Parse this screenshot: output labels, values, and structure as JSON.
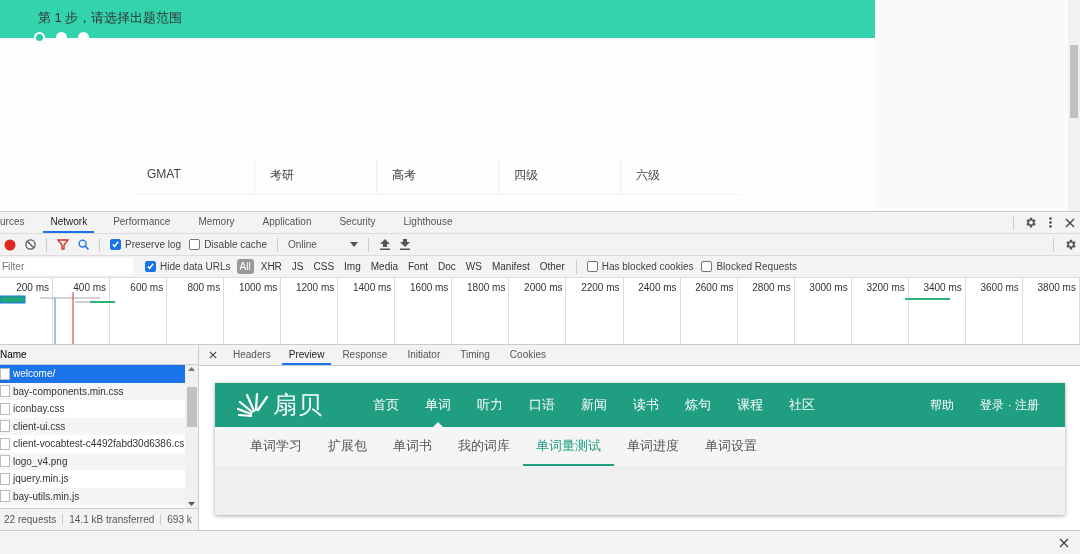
{
  "page": {
    "step_title": "第 1 步，请选择出题范围",
    "steps": [
      {
        "selected": true
      },
      {
        "selected": false
      },
      {
        "selected": false
      }
    ],
    "categories": [
      "GMAT",
      "考研",
      "高考",
      "四级",
      "六级"
    ]
  },
  "devtools": {
    "tabs": [
      {
        "label": "urces",
        "selected": false
      },
      {
        "label": "Network",
        "selected": true
      },
      {
        "label": "Performance",
        "selected": false
      },
      {
        "label": "Memory",
        "selected": false
      },
      {
        "label": "Application",
        "selected": false
      },
      {
        "label": "Security",
        "selected": false
      },
      {
        "label": "Lighthouse",
        "selected": false
      }
    ],
    "toolbar": {
      "checkboxes": [
        {
          "label": "Preserve log",
          "checked": true
        },
        {
          "label": "Disable cache",
          "checked": false
        }
      ],
      "throttle": "Online"
    },
    "filter_bar": {
      "placeholder": "Filter",
      "hide_data_urls": {
        "label": "Hide data URLs",
        "checked": true
      },
      "types": [
        {
          "label": "All",
          "selected": true
        },
        {
          "label": "XHR",
          "selected": false
        },
        {
          "label": "JS",
          "selected": false
        },
        {
          "label": "CSS",
          "selected": false
        },
        {
          "label": "Img",
          "selected": false
        },
        {
          "label": "Media",
          "selected": false
        },
        {
          "label": "Font",
          "selected": false
        },
        {
          "label": "Doc",
          "selected": false
        },
        {
          "label": "WS",
          "selected": false
        },
        {
          "label": "Manifest",
          "selected": false
        },
        {
          "label": "Other",
          "selected": false
        }
      ],
      "blocked_options": [
        {
          "label": "Has blocked cookies",
          "checked": false
        },
        {
          "label": "Blocked Requests",
          "checked": false
        }
      ]
    },
    "timeline": {
      "ticks": [
        "200 ms",
        "400 ms",
        "600 ms",
        "800 ms",
        "1000 ms",
        "1200 ms",
        "1400 ms",
        "1600 ms",
        "1800 ms",
        "2000 ms",
        "2200 ms",
        "2400 ms",
        "2600 ms",
        "2800 ms",
        "3000 ms",
        "3200 ms",
        "3400 ms",
        "3600 ms",
        "3800 ms"
      ]
    },
    "requests": {
      "column": "Name",
      "rows": [
        {
          "name": "welcome/",
          "selected": true
        },
        {
          "name": "bay-components.min.css",
          "selected": false
        },
        {
          "name": "iconbay.css",
          "selected": false
        },
        {
          "name": "client-ui.css",
          "selected": false
        },
        {
          "name": "client-vocabtest-c4492fabd30d6386.cs",
          "selected": false
        },
        {
          "name": "logo_v4.png",
          "selected": false
        },
        {
          "name": "jquery.min.js",
          "selected": false
        },
        {
          "name": "bay-utils.min.js",
          "selected": false
        }
      ]
    },
    "status": [
      "22 requests",
      "14.1 kB transferred",
      "693 k"
    ],
    "detail_tabs": [
      {
        "label": "Headers",
        "selected": false
      },
      {
        "label": "Preview",
        "selected": true
      },
      {
        "label": "Response",
        "selected": false
      },
      {
        "label": "Initiator",
        "selected": false
      },
      {
        "label": "Timing",
        "selected": false
      },
      {
        "label": "Cookies",
        "selected": false
      }
    ],
    "preview": {
      "logo": "扇贝",
      "nav": [
        {
          "label": "首页",
          "selected": false
        },
        {
          "label": "单词",
          "selected": true
        },
        {
          "label": "听力",
          "selected": false
        },
        {
          "label": "口语",
          "selected": false
        },
        {
          "label": "新闻",
          "selected": false
        },
        {
          "label": "读书",
          "selected": false
        },
        {
          "label": "炼句",
          "selected": false
        },
        {
          "label": "课程",
          "selected": false
        },
        {
          "label": "社区",
          "selected": false
        }
      ],
      "nav_right": [
        "帮助",
        "登录 · 注册"
      ],
      "subnav": [
        {
          "label": "单词学习",
          "selected": false
        },
        {
          "label": "扩展包",
          "selected": false
        },
        {
          "label": "单词书",
          "selected": false
        },
        {
          "label": "我的词库",
          "selected": false
        },
        {
          "label": "单词量测试",
          "selected": true
        },
        {
          "label": "单词进度",
          "selected": false
        },
        {
          "label": "单词设置",
          "selected": false
        }
      ]
    }
  }
}
